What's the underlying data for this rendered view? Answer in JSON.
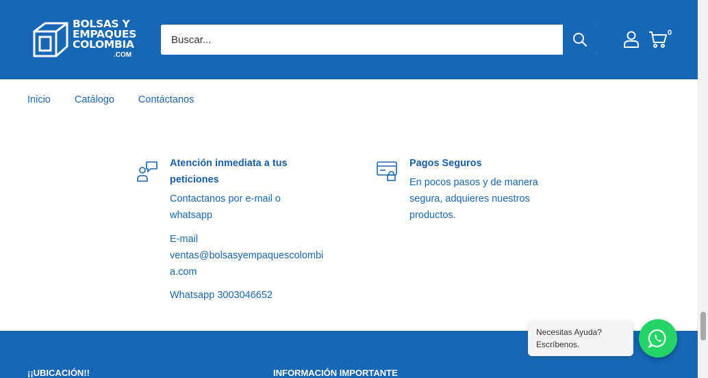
{
  "header": {
    "logo": {
      "line1": "BOLSAS Y",
      "line2": "EMPAQUES",
      "line3": "COLOMBIA",
      "suffix": ".COM"
    },
    "search": {
      "placeholder": "Buscar..."
    },
    "cart_count": "0"
  },
  "nav": {
    "items": [
      {
        "label": "Inicio"
      },
      {
        "label": "Catálogo"
      },
      {
        "label": "Contáctanos"
      }
    ]
  },
  "features": {
    "support": {
      "title_l1": "Atención inmediata a tus",
      "title_l2": "peticiones",
      "text_l1": "Contactanos por e-mail o",
      "text_l2": "whatsapp",
      "email_label": "E-mail",
      "email_l1": "ventas@bolsasyempaquescolombi",
      "email_l2": "a.com",
      "whatsapp": "Whatsapp 3003046652"
    },
    "payments": {
      "title": "Pagos Seguros",
      "text_l1": "En pocos pasos y de manera",
      "text_l2": "segura, adquieres nuestros",
      "text_l3": "productos."
    }
  },
  "footer": {
    "col1": "¡¡UBICACIÓN!!",
    "col2": "INFORMACIÓN IMPORTANTE"
  },
  "chat": {
    "line1": "Necesitas Ayuda?",
    "line2": "Escríbenos."
  },
  "colors": {
    "brand": "#1668b4",
    "whatsapp": "#25d366"
  }
}
